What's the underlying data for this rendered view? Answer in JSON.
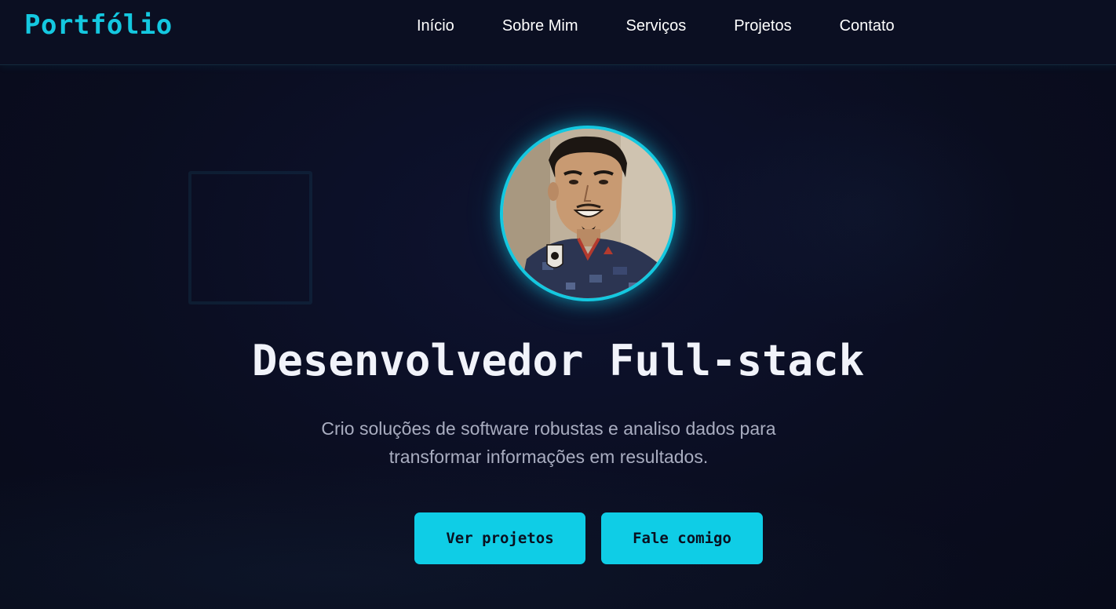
{
  "header": {
    "logo": "Portfólio",
    "nav": [
      {
        "label": "Início"
      },
      {
        "label": "Sobre Mim"
      },
      {
        "label": "Serviços"
      },
      {
        "label": "Projetos"
      },
      {
        "label": "Contato"
      }
    ]
  },
  "hero": {
    "avatar_icon": "profile-photo",
    "headline": "Desenvolvedor Full-stack",
    "subtitle": "Crio soluções de software robustas e analiso dados para transformar informações em resultados.",
    "primary_button": "Ver projetos",
    "secondary_button": "Fale comigo"
  },
  "colors": {
    "accent": "#14c8e0",
    "background": "#0a0d1f",
    "button_text": "#0a1020",
    "subtitle": "#a9adc0"
  }
}
